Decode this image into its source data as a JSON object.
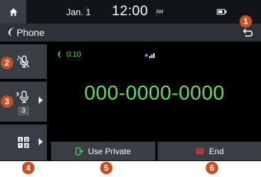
{
  "statusbar": {
    "home_icon": "home-icon",
    "date": "Jan. 1",
    "time": "12:00",
    "ampm": "AM",
    "battery_icon": "battery-icon"
  },
  "titlebar": {
    "icon": "phone-icon",
    "title": "Phone",
    "back_icon": "back-icon"
  },
  "sidebar": {
    "buttons": [
      {
        "icon": "mute-microphone-icon"
      },
      {
        "icon": "microphone-volume-icon",
        "count": "3"
      },
      {
        "icon": "keypad-icon"
      }
    ]
  },
  "call": {
    "timer": "0:10",
    "timer_icon": "active-call-icon",
    "signal_icon": "bluetooth-signal-icon",
    "number": "000-0000-0000",
    "number_color": "#6edb5b"
  },
  "bottom": {
    "use_private_label": "Use Private",
    "end_label": "End",
    "end_color": "#e53935"
  },
  "callouts": [
    "1",
    "2",
    "3",
    "4",
    "5",
    "6"
  ],
  "colors": {
    "callout": "#c84f20",
    "accent_green": "#5bd36a"
  }
}
